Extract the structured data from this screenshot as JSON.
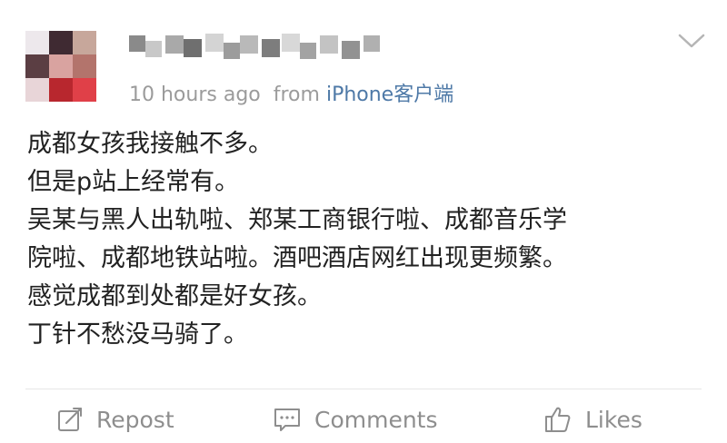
{
  "post": {
    "meta": {
      "time": "10 hours ago",
      "from_prefix": "from",
      "source": "iPhone客户端"
    },
    "content": [
      "成都女孩我接触不多。",
      "但是p站上经常有。",
      "吴某与黑人出轨啦、郑某工商银行啦、成都音乐学",
      "院啦、成都地铁站啦。酒吧酒店网红出现更频繁。",
      "感觉成都到处都是好女孩。",
      "丁针不愁没马骑了。"
    ]
  },
  "actions": {
    "repost": {
      "label": "Repost",
      "icon": "repost-icon"
    },
    "comments": {
      "label": "Comments",
      "icon": "comment-icon"
    },
    "likes": {
      "label": "Likes",
      "icon": "thumbs-up-icon"
    }
  },
  "colors": {
    "meta_gray": "#9b9b9b",
    "source_blue": "#4e79a7",
    "text": "#222222",
    "action_gray": "#8e8e8e"
  }
}
